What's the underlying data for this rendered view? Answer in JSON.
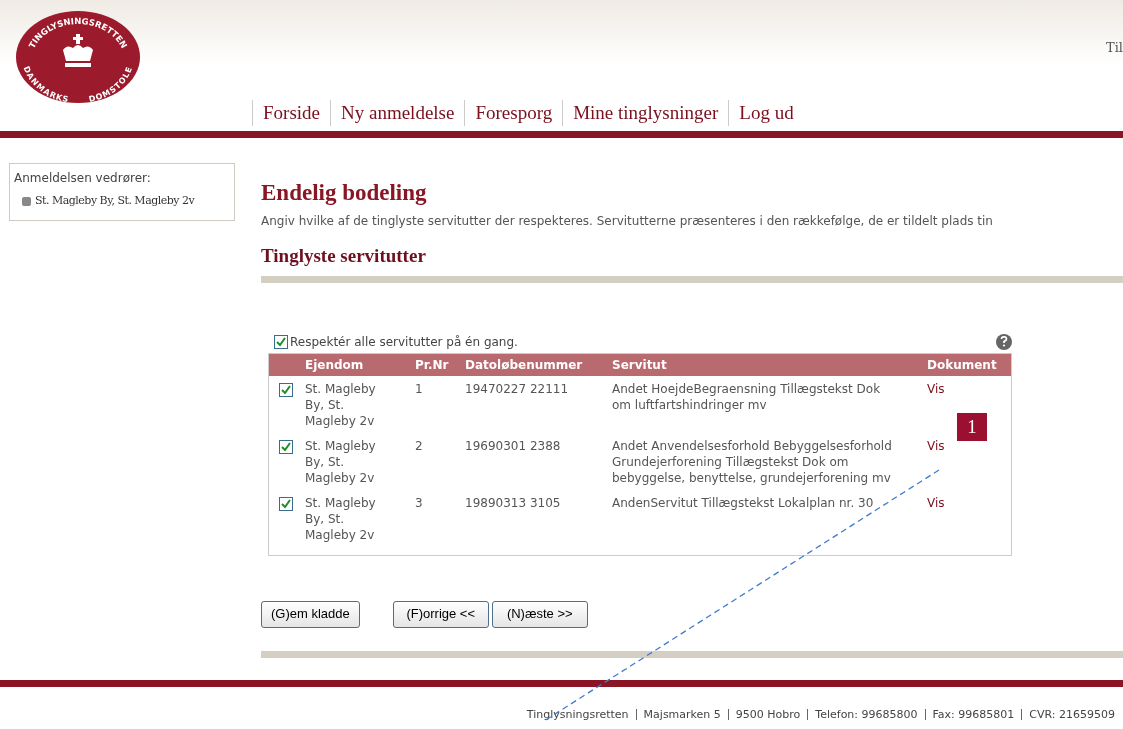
{
  "header": {
    "logo": {
      "top_text": "TINGLYSNINGSRETTEN",
      "bottom_text": "DANMARKS DOMSTOLE"
    },
    "top_link": "Til"
  },
  "nav": [
    {
      "label": "Forside"
    },
    {
      "label": "Ny anmeldelse"
    },
    {
      "label": "Foresporg"
    },
    {
      "label": "Mine tinglysninger"
    },
    {
      "label": "Log ud"
    }
  ],
  "sidebar": {
    "title": "Anmeldelsen vedrører:",
    "items": [
      "St. Magleby By, St. Magleby 2v"
    ]
  },
  "page_title": "Endelig bodeling",
  "intro": "Angiv hvilke af de tinglyste servitutter der respekteres. Servitutterne præsenteres i den rækkefølge, de er tildelt plads tin",
  "section_title": "Tinglyste servitutter",
  "select_all": {
    "label": "Respektér alle servitutter på én gang.",
    "checked": true
  },
  "table": {
    "columns": [
      "Ejendom",
      "Pr.Nr",
      "Datoløbenummer",
      "Servitut",
      "Dokument"
    ],
    "rows": [
      {
        "checked": true,
        "ejendom": "St. Magleby By, St. Magleby 2v",
        "pr_nr": "1",
        "datolobenummer": "19470227 22111",
        "servitut": "Andet HoejdeBegraensning Tillægstekst Dok om luftfartshindringer mv",
        "dokument": "Vis"
      },
      {
        "checked": true,
        "ejendom": "St. Magleby By, St. Magleby 2v",
        "pr_nr": "2",
        "datolobenummer": "19690301 2388",
        "servitut": "Andet Anvendelsesforhold Bebyggelsesforhold Grundejerforening Tillægstekst Dok om bebyggelse, benyttelse, grundejerforening mv",
        "dokument": "Vis"
      },
      {
        "checked": true,
        "ejendom": "St. Magleby By, St. Magleby 2v",
        "pr_nr": "3",
        "datolobenummer": "19890313 3105",
        "servitut": "AndenServitut Tillægstekst Lokalplan nr. 30",
        "dokument": "Vis"
      }
    ]
  },
  "buttons": [
    "(G)em kladde",
    "(F)orrige <<",
    "(N)æste >>"
  ],
  "callout": "1",
  "footer": [
    "Tinglysningsretten",
    "Majsmarken 5",
    "9500 Hobro",
    "Telefon: 99685800",
    "Fax: 99685801",
    "CVR: 21659509"
  ]
}
